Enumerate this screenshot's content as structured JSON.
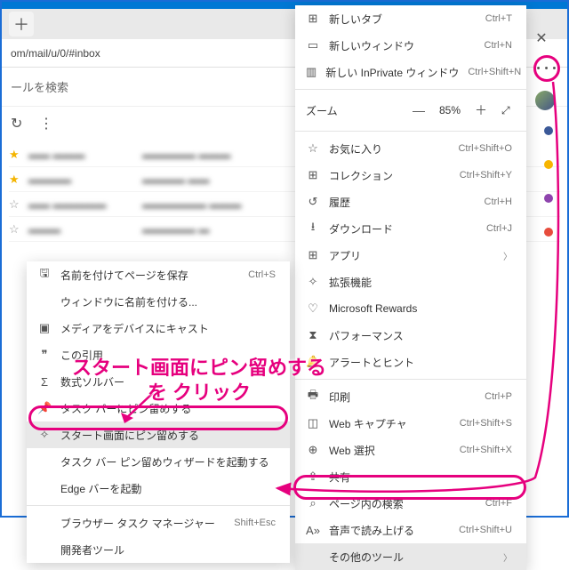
{
  "address": "om/mail/u/0/#inbox",
  "search_placeholder": "ールを検索",
  "zoom": {
    "label": "ズーム",
    "pct": "85%"
  },
  "main_menu": [
    {
      "icon": "⊞",
      "label": "新しいタブ",
      "sc": "Ctrl+T"
    },
    {
      "icon": "▭",
      "label": "新しいウィンドウ",
      "sc": "Ctrl+N"
    },
    {
      "icon": "▥",
      "label": "新しい InPrivate ウィンドウ",
      "sc": "Ctrl+Shift+N"
    },
    {
      "sep": true,
      "zoom": true
    },
    {
      "icon": "☆",
      "label": "お気に入り",
      "sc": "Ctrl+Shift+O"
    },
    {
      "icon": "⊞",
      "label": "コレクション",
      "sc": "Ctrl+Shift+Y"
    },
    {
      "icon": "↺",
      "label": "履歴",
      "sc": "Ctrl+H"
    },
    {
      "icon": "⭳",
      "label": "ダウンロード",
      "sc": "Ctrl+J"
    },
    {
      "icon": "⊞",
      "label": "アプリ",
      "chev": true
    },
    {
      "icon": "✧",
      "label": "拡張機能"
    },
    {
      "icon": "♡",
      "label": "Microsoft Rewards"
    },
    {
      "icon": "⧗",
      "label": "パフォーマンス"
    },
    {
      "icon": "🔔",
      "label": "アラートとヒント"
    },
    {
      "sep": true
    },
    {
      "icon": "🖶",
      "label": "印刷",
      "sc": "Ctrl+P"
    },
    {
      "icon": "◫",
      "label": "Web キャプチャ",
      "sc": "Ctrl+Shift+S"
    },
    {
      "icon": "⊕",
      "label": "Web 選択",
      "sc": "Ctrl+Shift+X"
    },
    {
      "icon": "⇪",
      "label": "共有"
    },
    {
      "icon": "⌕",
      "label": "ページ内の検索",
      "sc": "Ctrl+F"
    },
    {
      "icon": "A»",
      "label": "音声で読み上げる",
      "sc": "Ctrl+Shift+U"
    },
    {
      "icon": "",
      "label": "その他のツール",
      "chev": true,
      "hl": true
    }
  ],
  "sub_menu": [
    {
      "icon": "🖫",
      "label": "名前を付けてページを保存",
      "sc": "Ctrl+S"
    },
    {
      "icon": "",
      "label": "ウィンドウに名前を付ける..."
    },
    {
      "icon": "▣",
      "label": "メディアをデバイスにキャスト"
    },
    {
      "icon": "❞",
      "label": "この引用"
    },
    {
      "icon": "Σ",
      "label": "数式ソルバー"
    },
    {
      "icon": "📌",
      "label": "タスク バーにピン留めする"
    },
    {
      "icon": "✧",
      "label": "スタート画面にピン留めする",
      "hl": true
    },
    {
      "icon": "",
      "label": "タスク バー ピン留めウィザードを起動する"
    },
    {
      "icon": "",
      "label": "Edge バーを起動"
    },
    {
      "sep": true
    },
    {
      "icon": "",
      "label": "ブラウザー タスク マネージャー",
      "sc": "Shift+Esc"
    },
    {
      "icon": "",
      "label": "開発者ツール"
    }
  ],
  "annotation": "スタート画面にピン留めする\nを クリック",
  "mail_rows": [
    {
      "s": true,
      "a": "▬▬ ▬▬▬",
      "b": "▬▬▬▬▬ ▬▬▬"
    },
    {
      "s": true,
      "a": "▬▬▬▬",
      "b": "▬▬▬▬ ▬▬"
    },
    {
      "s": false,
      "a": "▬▬ ▬▬▬▬▬",
      "b": "▬▬▬▬▬▬ ▬▬▬"
    },
    {
      "s": false,
      "a": "▬▬▬",
      "b": "▬▬▬▬▬ ▬"
    }
  ],
  "sidedots": [
    "#3b5998",
    "#f7b500",
    "#8e44ad",
    "#e74c3c"
  ]
}
